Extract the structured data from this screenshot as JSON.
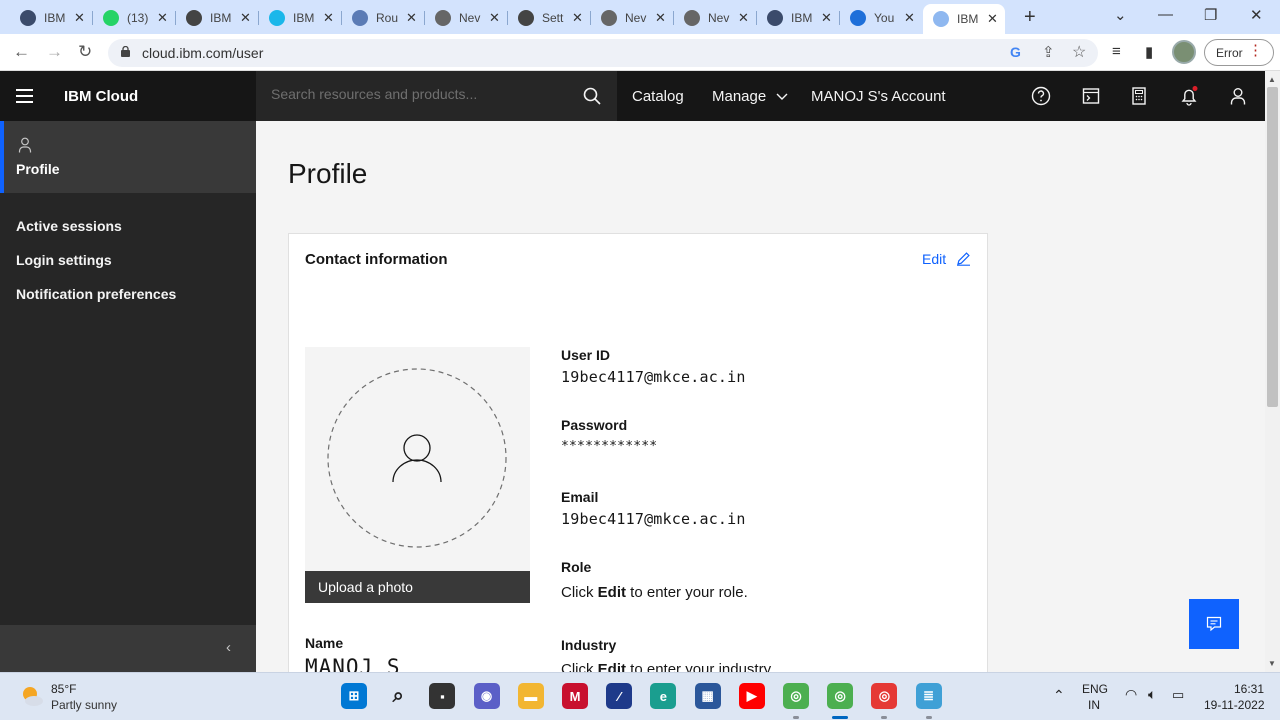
{
  "browser": {
    "tabs": [
      {
        "label": "IBM",
        "icon": "ibm-icon",
        "color": "#3b4b6b"
      },
      {
        "label": "(13)",
        "icon": "whatsapp-icon",
        "color": "#25d366"
      },
      {
        "label": "IBM",
        "icon": "globe-icon",
        "color": "#444444"
      },
      {
        "label": "IBM",
        "icon": "vimeo-icon",
        "color": "#1ab7ea"
      },
      {
        "label": "Rou",
        "icon": "router-icon",
        "color": "#5b7bb5"
      },
      {
        "label": "Nev",
        "icon": "chrome-icon",
        "color": "#666666"
      },
      {
        "label": "Sett",
        "icon": "settings-icon",
        "color": "#444444"
      },
      {
        "label": "Nev",
        "icon": "chrome-icon",
        "color": "#666666"
      },
      {
        "label": "Nev",
        "icon": "chrome-icon",
        "color": "#666666"
      },
      {
        "label": "IBM",
        "icon": "ibm-icon",
        "color": "#3b4b6b"
      },
      {
        "label": "You",
        "icon": "s-icon",
        "color": "#1e6fd9"
      },
      {
        "label": "IBM",
        "icon": "cloud-icon",
        "color": "#8fb8f0",
        "active": true
      }
    ],
    "url": "cloud.ibm.com/user",
    "profile_button": "Error"
  },
  "header": {
    "brand": "IBM Cloud",
    "search_placeholder": "Search resources and products...",
    "nav": {
      "catalog": "Catalog",
      "manage": "Manage",
      "account": "MANOJ S's Account"
    }
  },
  "sidebar": {
    "active_item": "Profile",
    "items": [
      {
        "label": "Active sessions"
      },
      {
        "label": "Login settings"
      },
      {
        "label": "Notification preferences"
      }
    ]
  },
  "main": {
    "title": "Profile",
    "card": {
      "title": "Contact information",
      "edit_label": "Edit",
      "upload_label": "Upload a photo",
      "fields": {
        "user_id_label": "User ID",
        "user_id_value": "19bec4117@mkce.ac.in",
        "password_label": "Password",
        "password_value": "************",
        "email_label": "Email",
        "email_value": "19bec4117@mkce.ac.in",
        "role_label": "Role",
        "role_prefix": "Click ",
        "role_bold": "Edit",
        "role_suffix": " to enter your role.",
        "industry_label": "Industry",
        "industry_prefix": "Click ",
        "industry_bold": "Edit",
        "industry_suffix": " to enter your industry.",
        "name_label": "Name",
        "name_value": "MANOJ S"
      }
    }
  },
  "taskbar": {
    "weather_temp": "85°F",
    "weather_desc": "Partly sunny",
    "lang_top": "ENG",
    "lang_bottom": "IN",
    "time": "16:31",
    "date": "19-11-2022"
  },
  "colors": {
    "accent": "#0f62fe",
    "header_bg": "#161616",
    "sidenav_bg": "#262626"
  }
}
